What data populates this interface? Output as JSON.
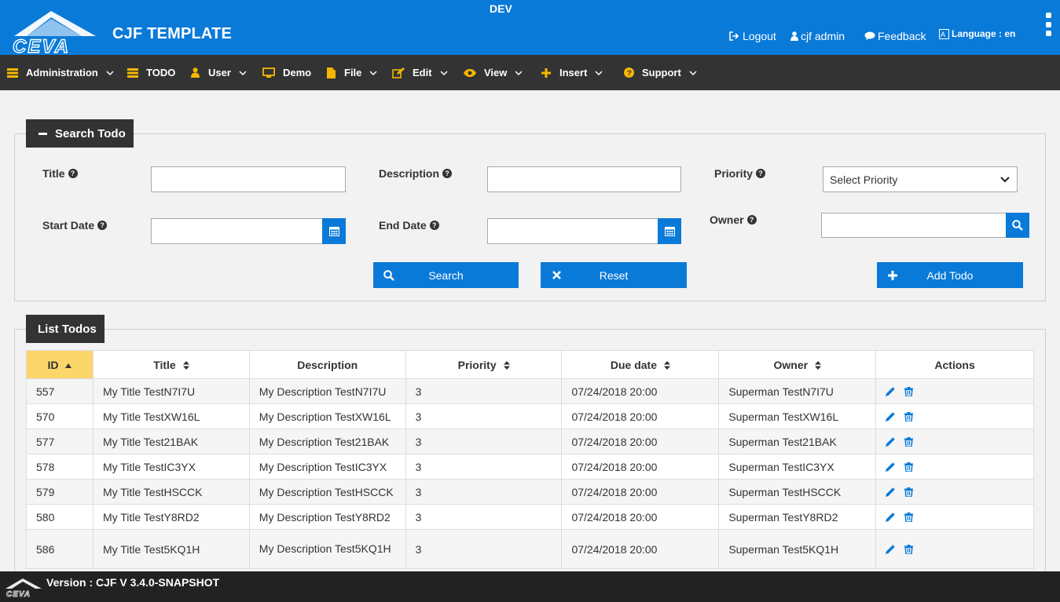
{
  "header": {
    "app_title": "CJF TEMPLATE",
    "environment": "DEV",
    "logo_text": "CEVA",
    "links": {
      "logout": "Logout",
      "user": "cjf admin",
      "feedback": "Feedback",
      "language": "Language : en"
    }
  },
  "menu": {
    "items": [
      {
        "label": "Administration",
        "icon": "list-icon",
        "has_dropdown": true
      },
      {
        "label": "TODO",
        "icon": "list-icon",
        "has_dropdown": false
      },
      {
        "label": "User",
        "icon": "user-icon",
        "has_dropdown": true
      },
      {
        "label": "Demo",
        "icon": "monitor-icon",
        "has_dropdown": false
      },
      {
        "label": "File",
        "icon": "file-icon",
        "has_dropdown": true
      },
      {
        "label": "Edit",
        "icon": "edit-icon",
        "has_dropdown": true
      },
      {
        "label": "View",
        "icon": "eye-icon",
        "has_dropdown": true
      },
      {
        "label": "Insert",
        "icon": "plus-icon",
        "has_dropdown": true
      },
      {
        "label": "Support",
        "icon": "question-icon",
        "has_dropdown": true
      }
    ],
    "icon_color": "#f5b800"
  },
  "search_panel": {
    "title": "Search Todo",
    "fields": {
      "title_label": "Title",
      "title_value": "",
      "description_label": "Description",
      "description_value": "",
      "priority_label": "Priority",
      "priority_selected": "Select Priority",
      "start_date_label": "Start Date",
      "start_date_value": "",
      "end_date_label": "End Date",
      "end_date_value": "",
      "owner_label": "Owner",
      "owner_value": ""
    },
    "buttons": {
      "search": "Search",
      "reset": "Reset",
      "add": "Add Todo"
    }
  },
  "list_panel": {
    "title": "List Todos",
    "columns": [
      "ID",
      "Title",
      "Description",
      "Priority",
      "Due date",
      "Owner",
      "Actions"
    ],
    "sorted_column": "ID",
    "rows": [
      {
        "id": "557",
        "title": "My Title TestN7I7U",
        "description": "My Description TestN7I7U",
        "priority": "3",
        "due": "07/24/2018 20:00",
        "owner": "Superman TestN7I7U"
      },
      {
        "id": "570",
        "title": "My Title TestXW16L",
        "description": "My Description TestXW16L",
        "priority": "3",
        "due": "07/24/2018 20:00",
        "owner": "Superman TestXW16L"
      },
      {
        "id": "577",
        "title": "My Title Test21BAK",
        "description": "My Description Test21BAK",
        "priority": "3",
        "due": "07/24/2018 20:00",
        "owner": "Superman Test21BAK"
      },
      {
        "id": "578",
        "title": "My Title TestIC3YX",
        "description": "My Description TestIC3YX",
        "priority": "3",
        "due": "07/24/2018 20:00",
        "owner": "Superman TestIC3YX"
      },
      {
        "id": "579",
        "title": "My Title TestHSCCK",
        "description": "My Description TestHSCCK",
        "priority": "3",
        "due": "07/24/2018 20:00",
        "owner": "Superman TestHSCCK"
      },
      {
        "id": "580",
        "title": "My Title TestY8RD2",
        "description": "My Description TestY8RD2",
        "priority": "3",
        "due": "07/24/2018 20:00",
        "owner": "Superman TestY8RD2"
      },
      {
        "id": "586",
        "title": "My Title Test5KQ1H",
        "description": "My Description Test5KQ1H",
        "priority": "3",
        "due": "07/24/2018 20:00",
        "owner": "Superman Test5KQ1H"
      }
    ]
  },
  "footer": {
    "version": "Version : CJF V 3.4.0-SNAPSHOT"
  },
  "colors": {
    "primary": "#0a7ad8",
    "dark": "#333333",
    "sorted_header": "#fcd56b",
    "accent": "#f5b800"
  }
}
